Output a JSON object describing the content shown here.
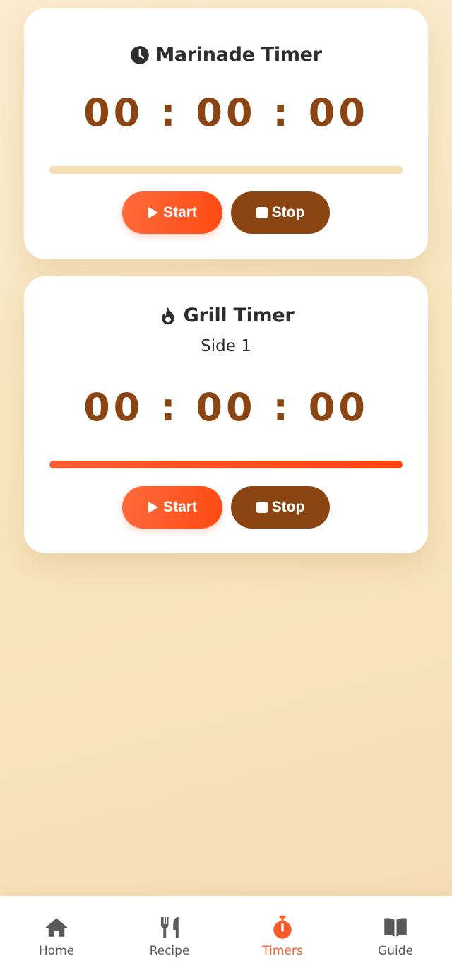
{
  "timers": [
    {
      "title": "Marinade Timer",
      "icon": "clock-icon",
      "subtitle": "",
      "display": "00 : 00 : 00",
      "progress": 0,
      "start_label": "Start",
      "stop_label": "Stop"
    },
    {
      "title": "Grill Timer",
      "icon": "fire-icon",
      "subtitle": "Side 1",
      "display": "00 : 00 : 00",
      "progress": 1,
      "start_label": "Start",
      "stop_label": "Stop"
    }
  ],
  "nav": {
    "items": [
      {
        "label": "Home",
        "icon": "home-icon",
        "active": false
      },
      {
        "label": "Recipe",
        "icon": "utensils-icon",
        "active": false
      },
      {
        "label": "Timers",
        "icon": "stopwatch-icon",
        "active": true
      },
      {
        "label": "Guide",
        "icon": "book-icon",
        "active": false
      }
    ]
  },
  "colors": {
    "accent": "#ff5a2a",
    "brown": "#8b4513",
    "track": "#f5deb3",
    "text": "#2e2e2e",
    "nav_inactive": "#5a5a5a"
  }
}
